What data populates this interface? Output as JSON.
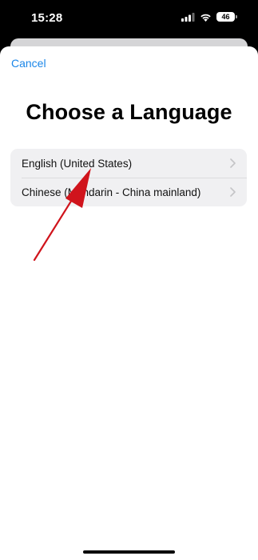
{
  "status_bar": {
    "time": "15:28",
    "battery": "46"
  },
  "sheet": {
    "cancel_label": "Cancel",
    "title": "Choose a Language",
    "languages": [
      {
        "label": "English (United States)"
      },
      {
        "label": "Chinese (Mandarin - China mainland)"
      }
    ]
  },
  "colors": {
    "accent": "#1a86e8",
    "annotation_arrow": "#d0141c",
    "list_background": "#f0f0f2"
  },
  "icons": {
    "signal": "signal-icon",
    "wifi": "wifi-icon",
    "battery": "battery-icon",
    "chevron": "chevron-right-icon",
    "annotation": "red-arrow-annotation"
  }
}
